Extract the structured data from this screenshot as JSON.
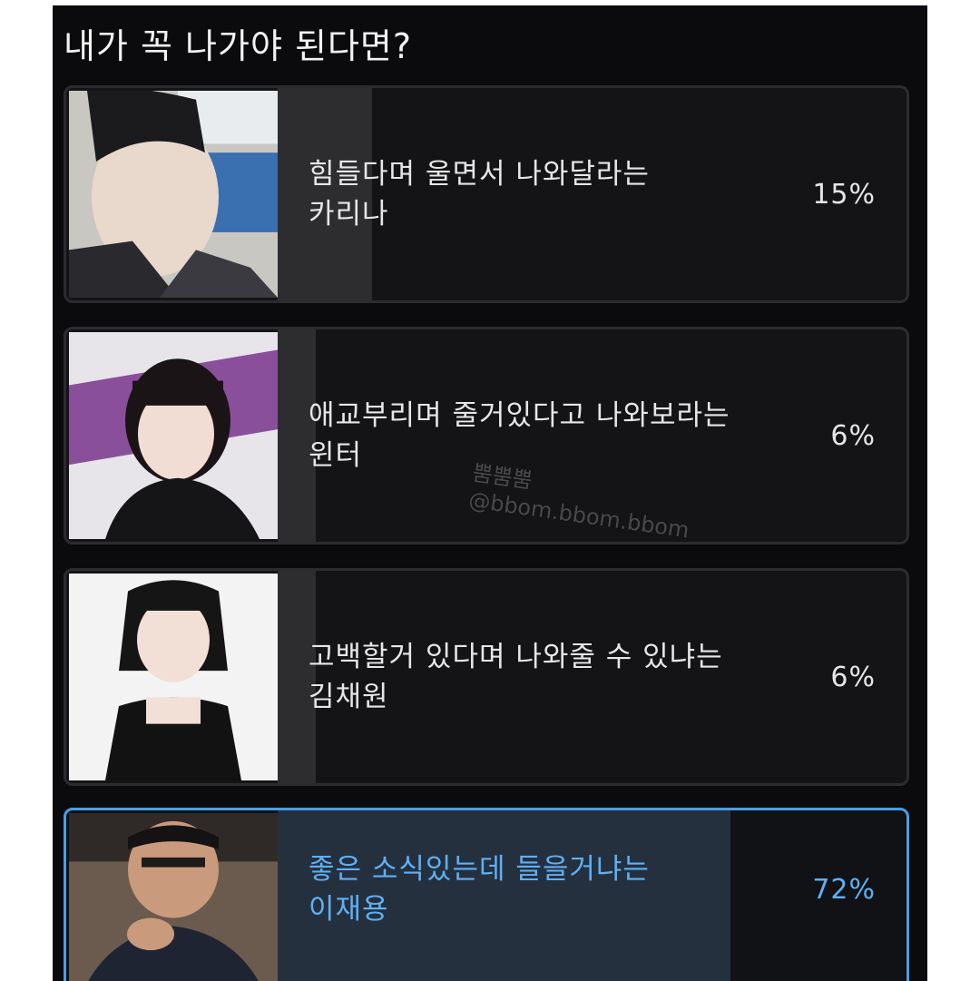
{
  "poll": {
    "title": "내가 꼭 나가야 된다면?",
    "options": [
      {
        "line1": "힘들다며 울면서 나와달라는",
        "line2": "카리나",
        "percent_label": "15%",
        "percent": 15,
        "selected": false
      },
      {
        "line1": "애교부리며 줄거있다고 나와보라는",
        "line2": "윈터",
        "percent_label": "6%",
        "percent": 6,
        "selected": false
      },
      {
        "line1": "고백할거 있다며 나와줄 수 있냐는",
        "line2": "김채원",
        "percent_label": "6%",
        "percent": 6,
        "selected": false
      },
      {
        "line1": "좋은 소식있는데 들을거냐는",
        "line2": "이재용",
        "percent_label": "72%",
        "percent": 72,
        "selected": true
      }
    ]
  },
  "watermark": {
    "line1": "뿜뿜뿜",
    "line2": "@bbom.bbom.bbom"
  },
  "colors": {
    "background": "#0b0b0d",
    "option_background": "#141416",
    "result_fill": "#2d2d30",
    "selected_accent": "#4a9fe6",
    "text": "#e6e6e6"
  }
}
